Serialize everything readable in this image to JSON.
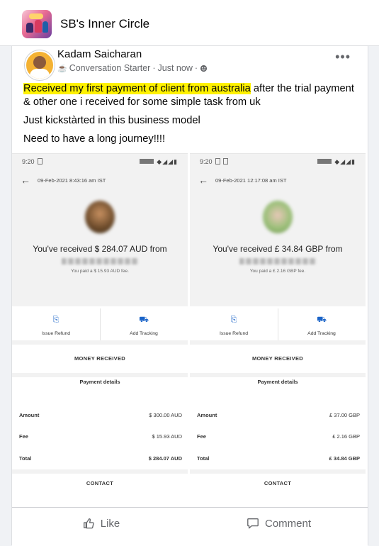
{
  "group": {
    "name": "SB's Inner Circle"
  },
  "post": {
    "author": "Kadam Saicharan",
    "badge": "Conversation Starter",
    "time": "Just now",
    "separator": "·",
    "more": "•••",
    "text_highlight": "Received my first payment of client from australia",
    "text_rest": " after the trial payment & other one i received for some simple task from uk",
    "line2": "Just kickstàrted in this business model",
    "line3": "Need to have a long journey!!!!"
  },
  "screenshots": [
    {
      "time": "9:20",
      "signal": "◆◢◢▮",
      "back": "←",
      "date": "09-Feb-2021 8:43:16 am IST",
      "received": "You've received $ 284.07 AUD from",
      "fee_note": "You paid a $ 15.93 AUD fee.",
      "issue_refund": "Issue Refund",
      "add_tracking": "Add Tracking",
      "money_received": "MONEY RECEIVED",
      "payment_details": "Payment details",
      "amount_label": "Amount",
      "amount_value": "$ 300.00 AUD",
      "fee_label": "Fee",
      "fee_value": "$ 15.93 AUD",
      "total_label": "Total",
      "total_value": "$ 284.07 AUD",
      "contact": "CONTACT",
      "avatar_color": "#7a5a3a"
    },
    {
      "time": "9:20",
      "signal": "◆◢◢▮",
      "back": "←",
      "date": "09-Feb-2021 12:17:08 am IST",
      "received": "You've received £ 34.84 GBP from",
      "fee_note": "You paid a £ 2.16 GBP fee.",
      "issue_refund": "Issue Refund",
      "add_tracking": "Add Tracking",
      "money_received": "MONEY RECEIVED",
      "payment_details": "Payment details",
      "amount_label": "Amount",
      "amount_value": "£ 37.00 GBP",
      "fee_label": "Fee",
      "fee_value": "£ 2.16 GBP",
      "total_label": "Total",
      "total_value": "£ 34.84 GBP",
      "contact": "CONTACT",
      "avatar_color": "#9cc07a"
    }
  ],
  "footer": {
    "like": "Like",
    "comment": "Comment"
  }
}
